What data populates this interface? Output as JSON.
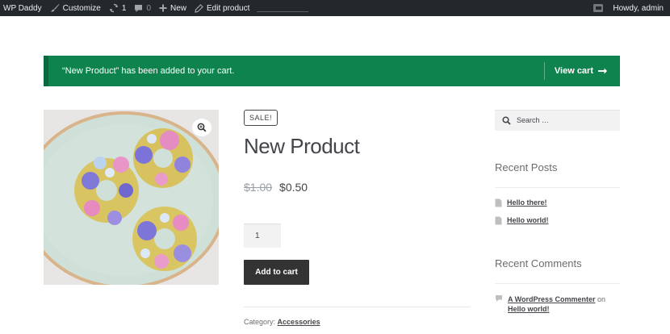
{
  "adminbar": {
    "site_name": "WP Daddy",
    "customize": "Customize",
    "updates_count": "1",
    "comments_count": "0",
    "new": "New",
    "edit_product": "Edit product",
    "howdy": "Howdy, admin"
  },
  "notice": {
    "message": "“New Product” has been added to your cart.",
    "view_cart": "View cart",
    "color": "#0f834d"
  },
  "product": {
    "sale_badge": "SALE!",
    "title": "New Product",
    "price_old": "$1.00",
    "price_new": "$0.50",
    "quantity": "1",
    "add_to_cart": "Add to cart",
    "category_label": "Category:",
    "category": "Accessories"
  },
  "sidebar": {
    "search_placeholder": "Search …",
    "recent_posts_title": "Recent Posts",
    "posts": [
      "Hello there!",
      "Hello world!"
    ],
    "recent_comments_title": "Recent Comments",
    "comment": {
      "author": "A WordPress Commenter",
      "on": "on",
      "post": "Hello world!"
    }
  }
}
